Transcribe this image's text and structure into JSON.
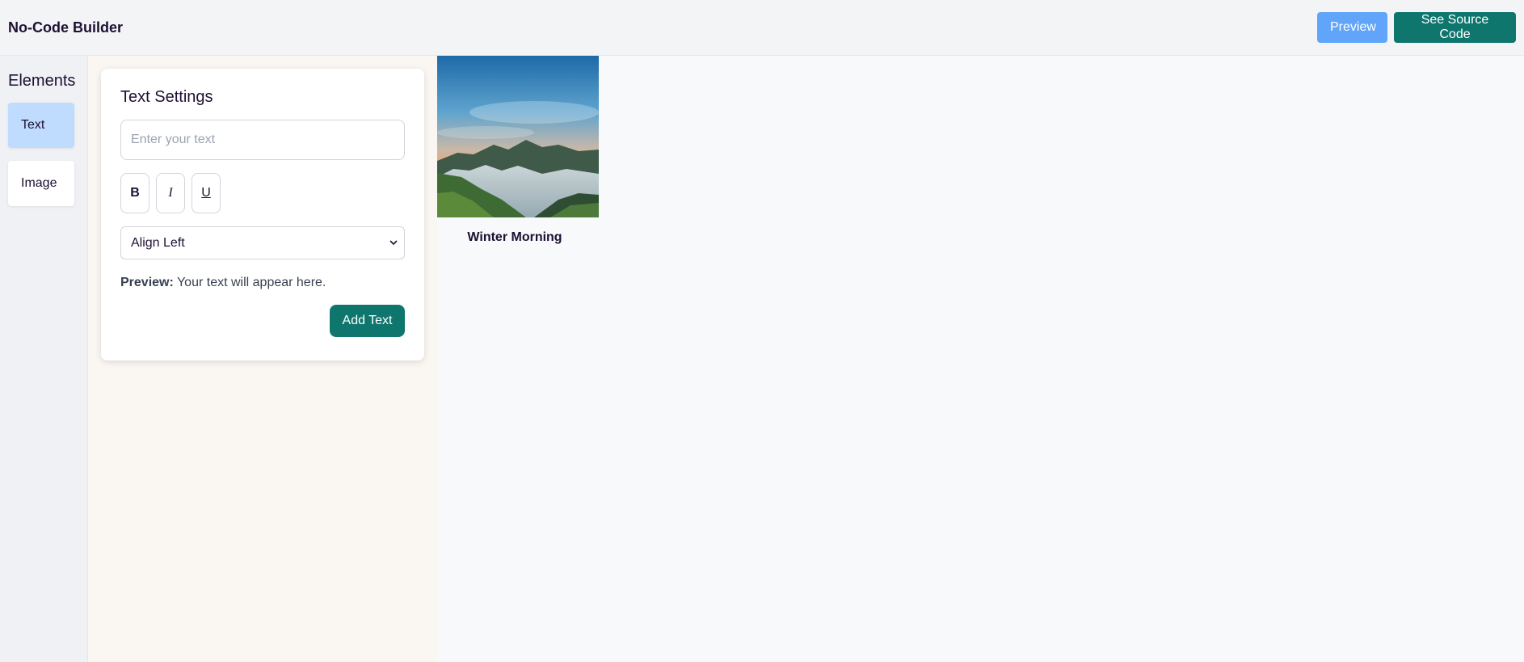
{
  "header": {
    "title": "No-Code Builder",
    "preview_label": "Preview",
    "source_label": "See Source Code"
  },
  "sidebar": {
    "title": "Elements",
    "items": [
      {
        "label": "Text",
        "active": true
      },
      {
        "label": "Image",
        "active": false
      }
    ]
  },
  "settings": {
    "title": "Text Settings",
    "text_input": {
      "value": "",
      "placeholder": "Enter your text"
    },
    "format_buttons": {
      "bold": "B",
      "italic": "I",
      "underline": "U"
    },
    "align_select": {
      "selected": "Align Left"
    },
    "preview_label": "Preview:",
    "preview_text": "Your text will appear here.",
    "add_button": "Add Text"
  },
  "canvas": {
    "image": {
      "caption": "Winter Morning"
    }
  },
  "colors": {
    "accent": "#0f766e",
    "preview_button": "#60a5fa",
    "active_item": "#bfdbfe"
  }
}
